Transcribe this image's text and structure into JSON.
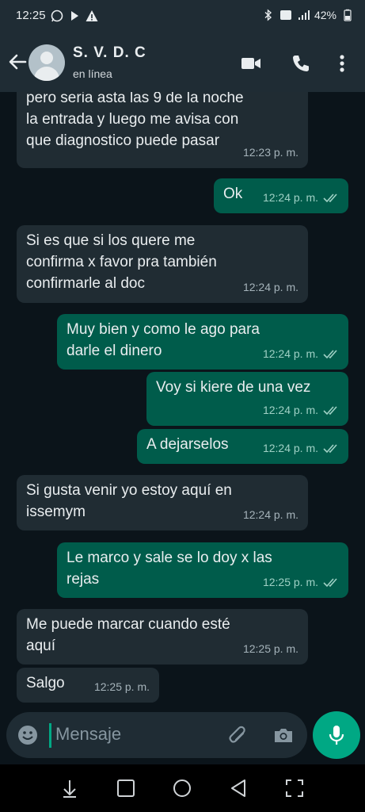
{
  "status_bar": {
    "time": "12:25",
    "battery": "42%"
  },
  "header": {
    "name": "S. V. D. C",
    "status": "en línea"
  },
  "messages": [
    {
      "dir": "in",
      "lines": "pero seria asta las 9 de la noche\nla entrada y luego me avisa con\nque diagnostico puede pasar",
      "time": "12:23 p. m."
    },
    {
      "dir": "out",
      "lines": "Ok",
      "time": "12:24 p. m."
    },
    {
      "dir": "in",
      "lines": "Si es que si los quere me\nconfirma x favor pra también\nconfirmarle al doc",
      "time": "12:24 p. m."
    },
    {
      "dir": "out",
      "lines": "Muy bien y como le ago para\ndarle el dinero",
      "time": "12:24 p. m."
    },
    {
      "dir": "out",
      "lines": "Voy si kiere de una vez",
      "time": "12:24 p. m."
    },
    {
      "dir": "out",
      "lines": "A dejarselos",
      "time": "12:24 p. m."
    },
    {
      "dir": "in",
      "lines": "Si gusta venir yo estoy aquí en\nissemym",
      "time": "12:24 p. m."
    },
    {
      "dir": "out",
      "lines": "Le marco y sale se lo doy x las\nrejas",
      "time": "12:25 p. m."
    },
    {
      "dir": "in",
      "lines": "Me puede marcar cuando esté\naquí",
      "time": "12:25 p. m."
    },
    {
      "dir": "in",
      "lines": "Salgo",
      "time": "12:25 p. m."
    }
  ],
  "input": {
    "placeholder": "Mensaje"
  },
  "colors": {
    "accent": "#00a884",
    "outgoing": "#005c4b",
    "incoming": "#202c33",
    "header": "#1f2c34"
  },
  "icons": [
    "whatsapp-icon",
    "play-icon",
    "warning-icon",
    "bluetooth-icon",
    "volte-icon",
    "signal-icon",
    "battery-icon",
    "back-arrow-icon",
    "video-call-icon",
    "phone-icon",
    "more-vert-icon",
    "emoji-icon",
    "attach-icon",
    "camera-icon",
    "mic-icon",
    "nav-down-icon",
    "nav-square-icon",
    "nav-circle-icon",
    "nav-back-icon",
    "nav-fullscreen-icon"
  ]
}
